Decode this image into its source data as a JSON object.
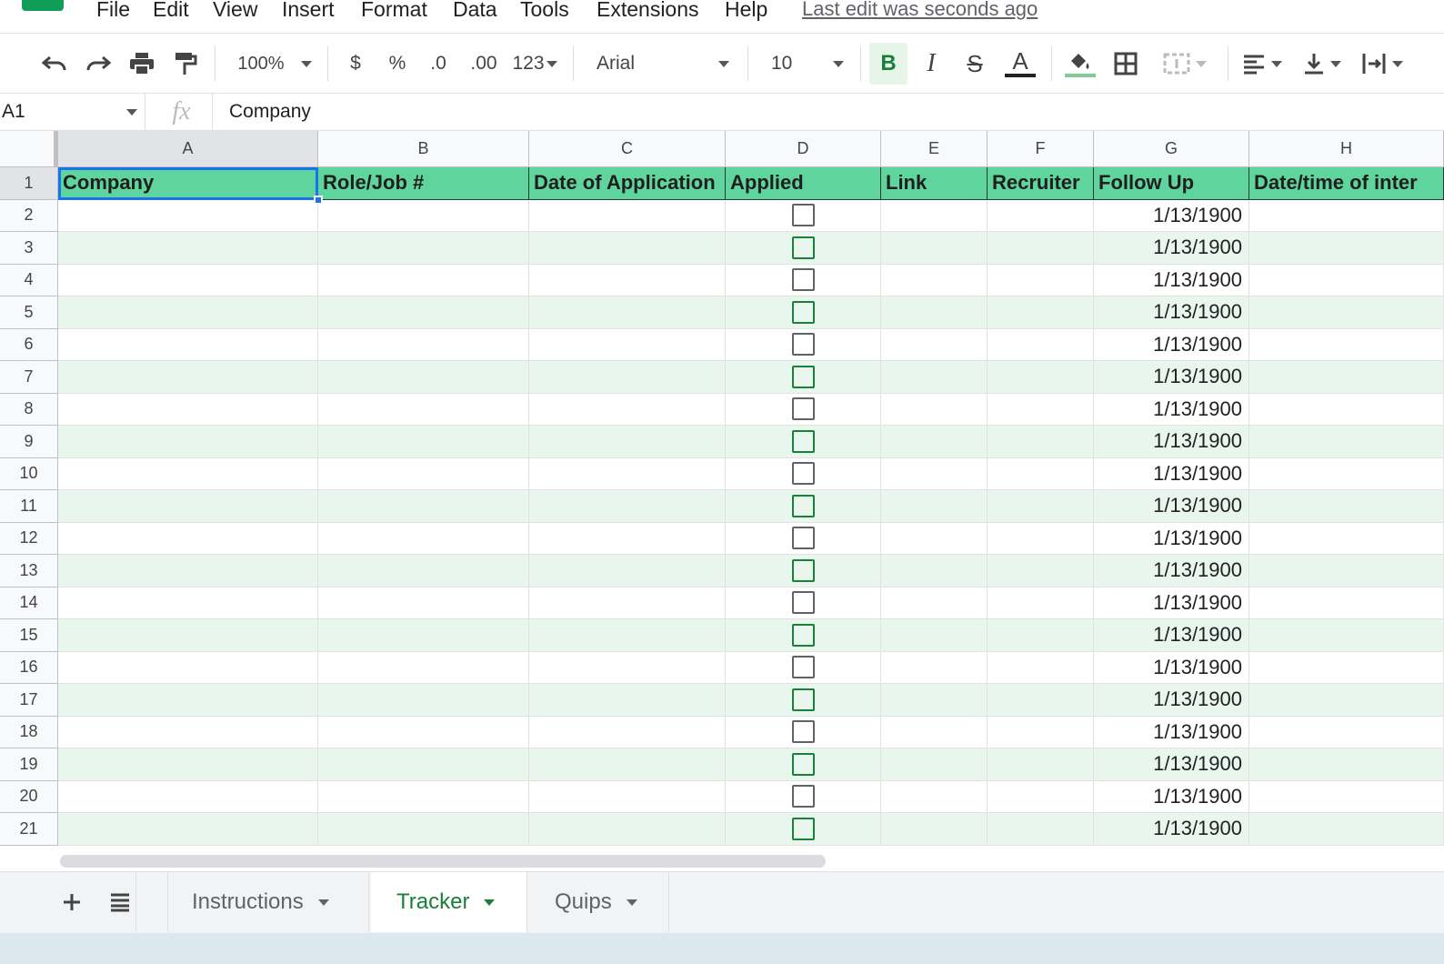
{
  "menu": {
    "items": [
      "File",
      "Edit",
      "View",
      "Insert",
      "Format",
      "Data",
      "Tools",
      "Extensions",
      "Help"
    ],
    "last_edit": "Last edit was seconds ago"
  },
  "toolbar": {
    "zoom": "100%",
    "currency": "$",
    "percent": "%",
    "decrease_decimal": ".0",
    "increase_decimal": ".00",
    "more_formats": "123",
    "font": "Arial",
    "font_size": "10",
    "bold": "B",
    "italic": "I",
    "strikethrough": "S",
    "text_color": "A",
    "colors": {
      "bold_active_bg": "#e6f4ea",
      "fill_underline": "#81c995"
    }
  },
  "formula_bar": {
    "name_box": "A1",
    "fx": "fx",
    "content": "Company"
  },
  "grid": {
    "columns": [
      "A",
      "B",
      "C",
      "D",
      "E",
      "F",
      "G",
      "H"
    ],
    "header_row": [
      "Company",
      "Role/Job #",
      "Date of Application",
      "Applied",
      "Link",
      "Recruiter",
      "Follow Up",
      "Date/time of inter"
    ],
    "row_numbers": [
      "1",
      "2",
      "3",
      "4",
      "5",
      "6",
      "7",
      "8",
      "9",
      "10",
      "11",
      "12",
      "13",
      "14",
      "15",
      "16",
      "17",
      "18",
      "19",
      "20",
      "21"
    ],
    "follow_up_value": "1/13/1900",
    "rows": [
      {
        "follow_up": "1/13/1900",
        "applied": false
      },
      {
        "follow_up": "1/13/1900",
        "applied": false
      },
      {
        "follow_up": "1/13/1900",
        "applied": false
      },
      {
        "follow_up": "1/13/1900",
        "applied": false
      },
      {
        "follow_up": "1/13/1900",
        "applied": false
      },
      {
        "follow_up": "1/13/1900",
        "applied": false
      },
      {
        "follow_up": "1/13/1900",
        "applied": false
      },
      {
        "follow_up": "1/13/1900",
        "applied": false
      },
      {
        "follow_up": "1/13/1900",
        "applied": false
      },
      {
        "follow_up": "1/13/1900",
        "applied": false
      },
      {
        "follow_up": "1/13/1900",
        "applied": false
      },
      {
        "follow_up": "1/13/1900",
        "applied": false
      },
      {
        "follow_up": "1/13/1900",
        "applied": false
      },
      {
        "follow_up": "1/13/1900",
        "applied": false
      },
      {
        "follow_up": "1/13/1900",
        "applied": false
      },
      {
        "follow_up": "1/13/1900",
        "applied": false
      },
      {
        "follow_up": "1/13/1900",
        "applied": false
      },
      {
        "follow_up": "1/13/1900",
        "applied": false
      },
      {
        "follow_up": "1/13/1900",
        "applied": false
      },
      {
        "follow_up": "1/13/1900",
        "applied": false
      }
    ],
    "colors": {
      "header_fill": "#5fd49c",
      "band_fill": "#e8f6ee",
      "checkbox_green": "#188038"
    }
  },
  "sheets": {
    "tabs": [
      "Instructions",
      "Tracker",
      "Quips"
    ],
    "active": "Tracker"
  }
}
